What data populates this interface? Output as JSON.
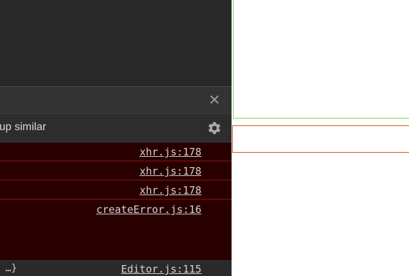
{
  "devtools": {
    "close_glyph": "✕",
    "settings_label": "up similar",
    "icons": {
      "close": "close-icon",
      "settings": "gear-icon"
    },
    "messages": [
      {
        "source": "xhr.js:178"
      },
      {
        "source": "xhr.js:178"
      },
      {
        "source": "xhr.js:178"
      },
      {
        "source": "createError.js:16"
      }
    ],
    "log": {
      "snippet": "…}",
      "source": "Editor.js:115"
    },
    "colors": {
      "error_background": "#290000",
      "error_border": "#5e0a0a",
      "panel_background": "#242424"
    }
  },
  "page": {
    "colors": {
      "green_outline": "#7fd14a",
      "orange_outline": "#cc5a12"
    }
  }
}
